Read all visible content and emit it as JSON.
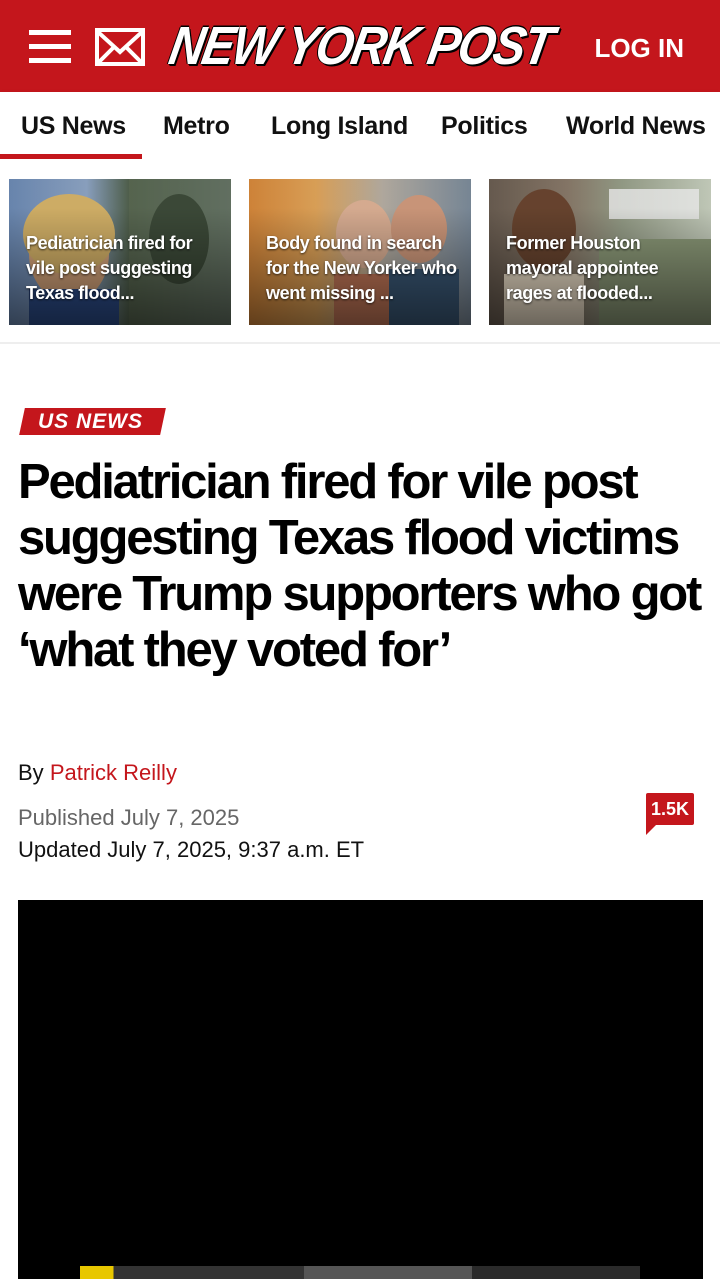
{
  "header": {
    "logo": "NEW YORK POST",
    "login_label": "LOG IN",
    "brand_color": "#c4161c",
    "menu_icon": "hamburger-menu-icon",
    "mail_icon": "envelope-icon"
  },
  "nav": {
    "tabs": [
      {
        "label": "US News",
        "active": true
      },
      {
        "label": "Metro"
      },
      {
        "label": "Long Island"
      },
      {
        "label": "Politics"
      },
      {
        "label": "World News"
      }
    ]
  },
  "cards": [
    {
      "caption": "Pediatrician fired for vile post suggesting Texas flood..."
    },
    {
      "caption": "Body found in search for the New Yorker who went missing ..."
    },
    {
      "caption": "Former Houston mayoral appointee rages at flooded..."
    }
  ],
  "article": {
    "section": "US NEWS",
    "headline": "Pediatrician fired for vile post suggesting Texas flood victims were Trump supporters who got ‘what they voted for’",
    "byline_prefix": "By",
    "author": "Patrick Reilly",
    "published": "Published July 7, 2025",
    "updated": "Updated July 7, 2025, 9:37 a.m. ET",
    "comment_count": "1.5K"
  }
}
